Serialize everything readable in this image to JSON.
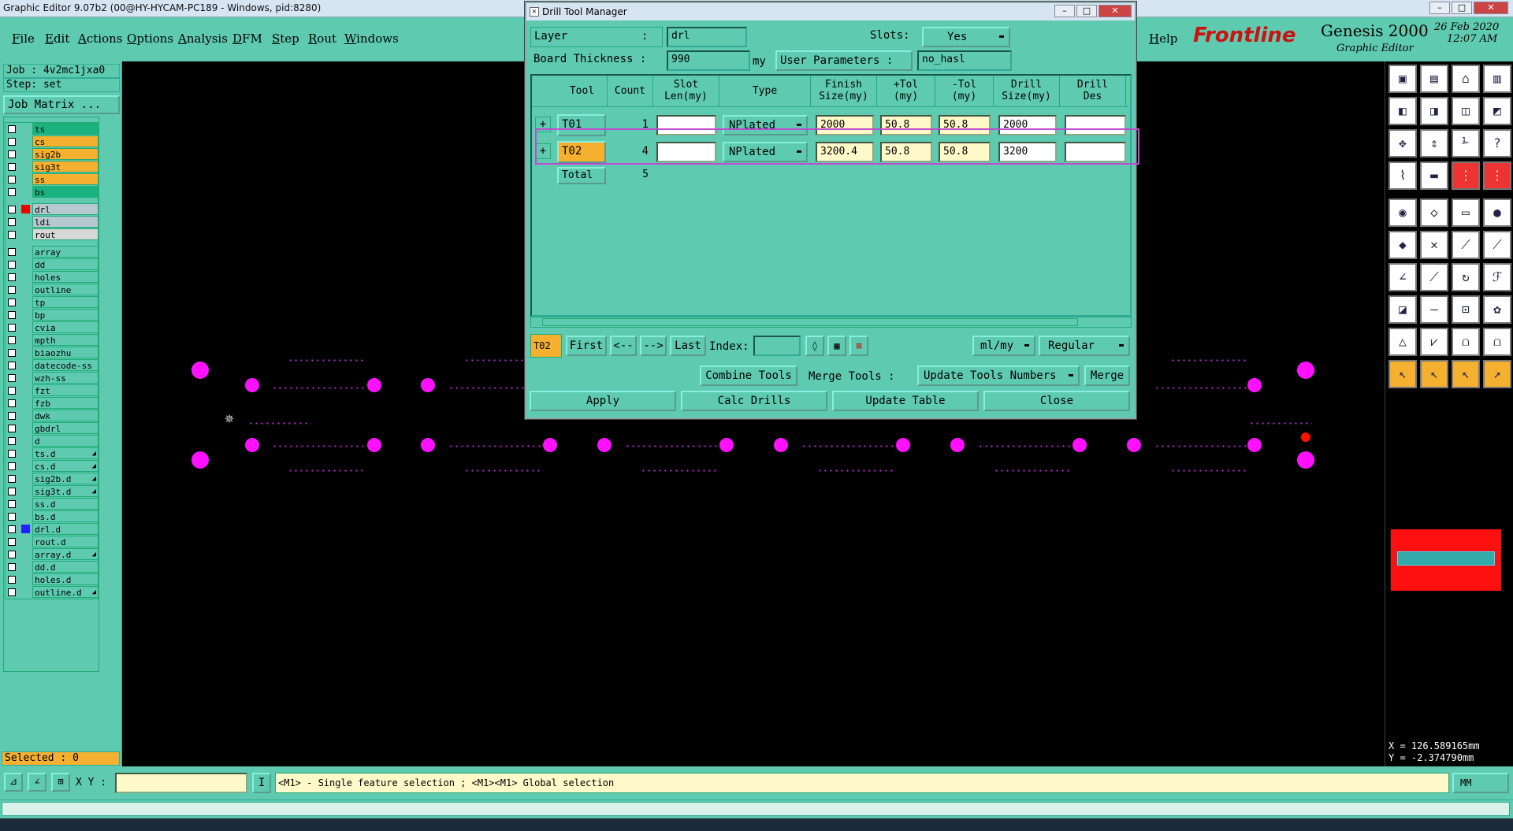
{
  "window": {
    "title": "Graphic Editor 9.07b2 (00@HY-HYCAM-PC189 - Windows, pid:8280)"
  },
  "menu": {
    "items": [
      "File",
      "Edit",
      "Actions",
      "Options",
      "Analysis",
      "DFM",
      "Step",
      "Rout",
      "Windows"
    ],
    "help": "Help"
  },
  "brand": {
    "logo": "Frontline",
    "product": "Genesis 2000",
    "subtitle": "Graphic Editor",
    "date": "26 Feb 2020",
    "time": "12:07 AM"
  },
  "job": {
    "job": "Job : 4v2mc1jxa0",
    "step": "Step: set",
    "matrix_button": "Job Matrix ..."
  },
  "layers": [
    {
      "name": "ts",
      "color": "#1ab37f"
    },
    {
      "name": "cs",
      "color": "#f5b030"
    },
    {
      "name": "sig2b",
      "color": "#f5b030"
    },
    {
      "name": "sig3t",
      "color": "#f5b030"
    },
    {
      "name": "ss",
      "color": "#f5b030"
    },
    {
      "name": "bs",
      "color": "#1ab37f"
    },
    {
      "sep": true
    },
    {
      "name": "drl",
      "color": "#b8c8d0",
      "work": true
    },
    {
      "name": "ldi",
      "color": "#b8c8d0"
    },
    {
      "name": "rout",
      "color": "#d8d8d8"
    },
    {
      "sep": true
    },
    {
      "name": "array",
      "color": "#5ecbb0"
    },
    {
      "name": "dd",
      "color": "#5ecbb0"
    },
    {
      "name": "holes",
      "color": "#5ecbb0"
    },
    {
      "name": "outline",
      "color": "#5ecbb0"
    },
    {
      "name": "tp",
      "color": "#5ecbb0"
    },
    {
      "name": "bp",
      "color": "#5ecbb0"
    },
    {
      "name": "cvia",
      "color": "#5ecbb0"
    },
    {
      "name": "mpth",
      "color": "#5ecbb0"
    },
    {
      "name": "biaozhu",
      "color": "#5ecbb0"
    },
    {
      "name": "datecode-ss",
      "color": "#5ecbb0"
    },
    {
      "name": "wzh-ss",
      "color": "#5ecbb0"
    },
    {
      "name": "fzt",
      "color": "#5ecbb0"
    },
    {
      "name": "fzb",
      "color": "#5ecbb0"
    },
    {
      "name": "dwk",
      "color": "#5ecbb0"
    },
    {
      "name": "gbdrl",
      "color": "#5ecbb0"
    },
    {
      "name": "d",
      "color": "#5ecbb0"
    },
    {
      "name": "ts.d",
      "color": "#5ecbb0",
      "arrow": true
    },
    {
      "name": "cs.d",
      "color": "#5ecbb0",
      "arrow": true
    },
    {
      "name": "sig2b.d",
      "color": "#5ecbb0",
      "arrow": true
    },
    {
      "name": "sig3t.d",
      "color": "#5ecbb0",
      "arrow": true
    },
    {
      "name": "ss.d",
      "color": "#5ecbb0"
    },
    {
      "name": "bs.d",
      "color": "#5ecbb0"
    },
    {
      "name": "drl.d",
      "color": "#5ecbb0",
      "blue": true
    },
    {
      "name": "rout.d",
      "color": "#5ecbb0"
    },
    {
      "name": "array.d",
      "color": "#5ecbb0",
      "arrow": true
    },
    {
      "name": "dd.d",
      "color": "#5ecbb0"
    },
    {
      "name": "holes.d",
      "color": "#5ecbb0"
    },
    {
      "name": "outline.d",
      "color": "#5ecbb0",
      "arrow": true
    }
  ],
  "selected": "Selected : 0",
  "status": {
    "xy_label": "X Y :",
    "message": "<M1> - Single feature selection ; <M1><M1> Global selection",
    "units": "MM"
  },
  "coords": {
    "x": "X = 126.589165mm",
    "y": "Y = -2.374790mm"
  },
  "dialog": {
    "title": "Drill Tool Manager",
    "layer_label": "Layer",
    "layer_colon": ":",
    "layer_value": "drl",
    "slots_label": "Slots:",
    "slots_value": "Yes",
    "board_thickness_label": "Board Thickness :",
    "board_thickness_value": "990",
    "board_thickness_unit": "my",
    "user_params_label": "User Parameters :",
    "user_params_value": "no_hasl",
    "columns": [
      "Tool",
      "Count",
      "Slot\nLen(my)",
      "Type",
      "Finish\nSize(my)",
      "+Tol\n(my)",
      "-Tol\n(my)",
      "Drill\nSize(my)",
      "Drill\nDes"
    ],
    "rows": [
      {
        "tool": "T01",
        "count": "1",
        "slot": "",
        "type": "NPlated",
        "finish": "2000",
        "ptol": "50.8",
        "mtol": "50.8",
        "drill": "2000",
        "des": ""
      },
      {
        "tool": "T02",
        "count": "4",
        "slot": "",
        "type": "NPlated",
        "finish": "3200.4",
        "ptol": "50.8",
        "mtol": "50.8",
        "drill": "3200",
        "des": ""
      }
    ],
    "total_label": "Total",
    "total_count": "5",
    "nav": {
      "current": "T02",
      "first": "First",
      "prev": "<--",
      "next": "-->",
      "last": "Last",
      "index_label": "Index:",
      "units": "ml/my",
      "mode": "Regular"
    },
    "actions": {
      "combine": "Combine Tools",
      "merge_label": "Merge Tools :",
      "merge_option": "Update Tools Numbers",
      "merge": "Merge"
    },
    "footer": {
      "apply": "Apply",
      "calc": "Calc Drills",
      "update": "Update Table",
      "close": "Close"
    }
  }
}
